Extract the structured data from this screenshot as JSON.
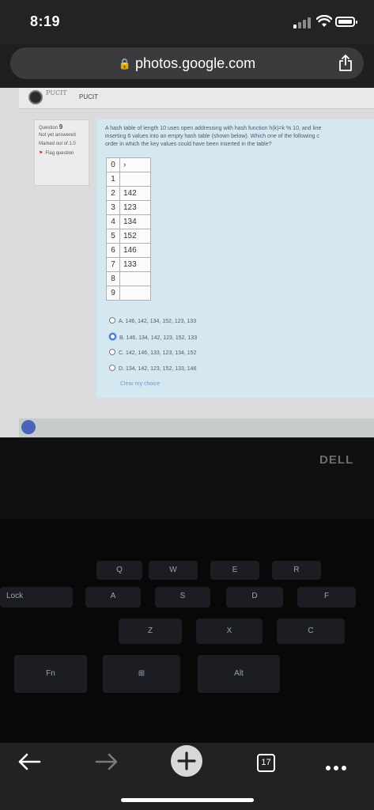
{
  "status": {
    "time": "8:19"
  },
  "browser": {
    "url": "photos.google.com",
    "tab_count": "17"
  },
  "moodle": {
    "site_name": "PUCIT",
    "logo_text": "PUCIT",
    "question_label": "Question",
    "question_number": "9",
    "state": "Not yet answered",
    "marked": "Marked out of 1.0",
    "flag_label": "Flag question",
    "question_lines": [
      "A hash table of length 10 uses open addressing with hash function h(k)=k % 10, and line",
      "inserting 6 values into an empty hash table (shown below). Which one of the following c",
      "order in which the key values could have been inserted in the table?"
    ],
    "table": [
      {
        "index": "0",
        "value": "›"
      },
      {
        "index": "1",
        "value": ""
      },
      {
        "index": "2",
        "value": "142"
      },
      {
        "index": "3",
        "value": "123"
      },
      {
        "index": "4",
        "value": "134"
      },
      {
        "index": "5",
        "value": "152"
      },
      {
        "index": "6",
        "value": "146"
      },
      {
        "index": "7",
        "value": "133"
      },
      {
        "index": "8",
        "value": ""
      },
      {
        "index": "9",
        "value": ""
      }
    ],
    "options": [
      {
        "label": "A. 146, 142, 134, 152, 123, 133",
        "selected": false
      },
      {
        "label": "B. 146, 134, 142, 123, 152, 133",
        "selected": true
      },
      {
        "label": "C. 142, 146, 133, 123, 134, 152",
        "selected": false
      },
      {
        "label": "D. 134, 142, 123, 152, 133, 146",
        "selected": false
      }
    ],
    "clear_choice": "Clear my choice"
  },
  "laptop": {
    "brand": "DELL",
    "keys": [
      {
        "label": "Q",
        "name": "key-q"
      },
      {
        "label": "W",
        "name": "key-w"
      },
      {
        "label": "E",
        "name": "key-e"
      },
      {
        "label": "R",
        "name": "key-r"
      },
      {
        "label": "A",
        "name": "key-a"
      },
      {
        "label": "S",
        "name": "key-s"
      },
      {
        "label": "D",
        "name": "key-d"
      },
      {
        "label": "F",
        "name": "key-f"
      },
      {
        "label": "Lock",
        "name": "key-caps-lock"
      },
      {
        "label": "Z",
        "name": "key-z"
      },
      {
        "label": "X",
        "name": "key-x"
      },
      {
        "label": "C",
        "name": "key-c"
      },
      {
        "label": "Fn",
        "name": "key-fn"
      },
      {
        "label": "⊞",
        "name": "key-windows"
      },
      {
        "label": "Alt",
        "name": "key-alt"
      }
    ]
  },
  "colors": {
    "selected_radio": "#3e78c8",
    "panel": "#d5e8f2",
    "link": "#6e9ac7"
  }
}
